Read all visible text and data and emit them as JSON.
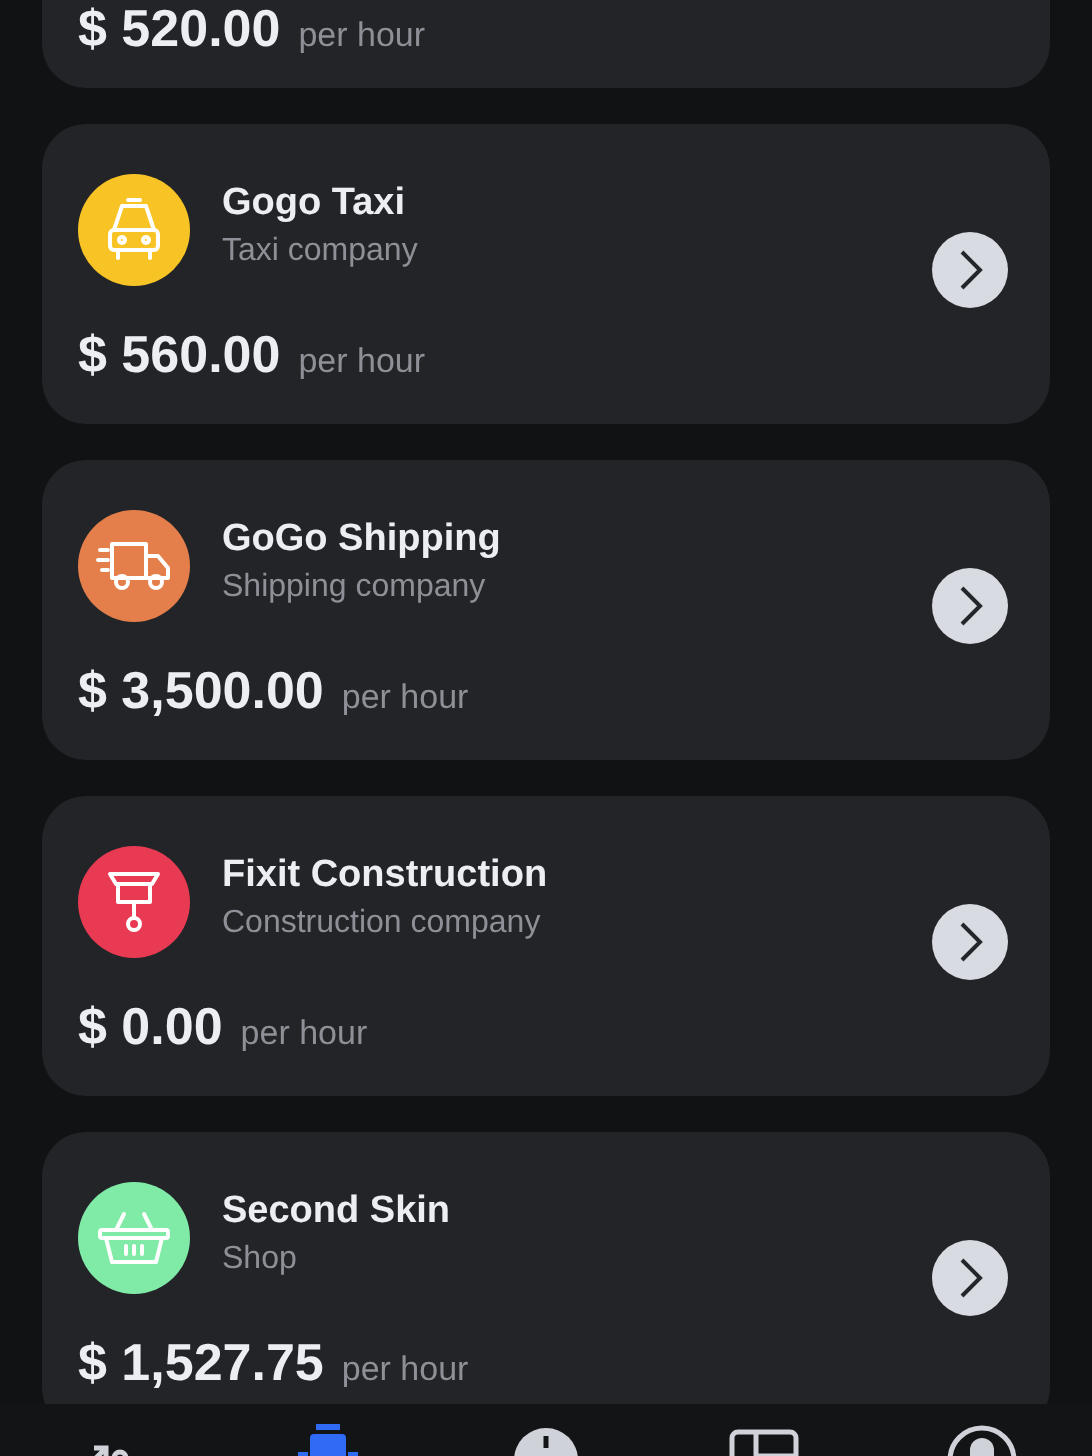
{
  "cards": [
    {
      "price": "$ 520.00",
      "unit": "per hour"
    },
    {
      "kind": "taxi",
      "color": "#f8c425",
      "name": "Gogo Taxi",
      "subtitle": "Taxi company",
      "price": "$ 560.00",
      "unit": "per hour"
    },
    {
      "kind": "truck",
      "color": "#e47f4c",
      "name": "GoGo Shipping",
      "subtitle": "Shipping company",
      "price": "$ 3,500.00",
      "unit": "per hour"
    },
    {
      "kind": "crane",
      "color": "#e83a52",
      "name": "Fixit Construction",
      "subtitle": "Construction company",
      "price": "$ 0.00",
      "unit": "per hour"
    },
    {
      "kind": "basket",
      "color": "#80eba6",
      "name": "Second Skin",
      "subtitle": "Shop",
      "price": "$ 1,527.75",
      "unit": "per hour"
    }
  ],
  "nav": [
    {
      "selected": false
    },
    {
      "selected": true
    },
    {
      "selected": false
    },
    {
      "selected": false
    },
    {
      "selected": false
    }
  ]
}
